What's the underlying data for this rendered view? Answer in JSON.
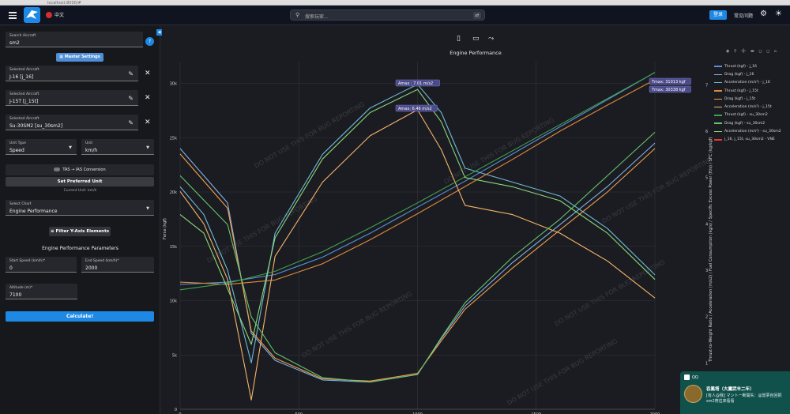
{
  "browser": {
    "url": "localhost:8000/#"
  },
  "topbar": {
    "lang_label": "中文",
    "search_placeholder": "搜索玩家...",
    "login_label": "登录",
    "faq_label": "常见问题"
  },
  "sidebar": {
    "search": {
      "label": "Search Aircraft",
      "value": "sm2"
    },
    "master_settings_label": "Master Settings",
    "selected": [
      {
        "label": "Selected Aircraft",
        "value": "J-16 [j_16]"
      },
      {
        "label": "Selected Aircraft",
        "value": "J-15T [j_15t]"
      },
      {
        "label": "Selected Aircraft",
        "value": "Su-30SM2 [su_30sm2]"
      }
    ],
    "unit_type": {
      "label": "Unit Type",
      "value": "Speed"
    },
    "unit": {
      "label": "Unit",
      "value": "km/h"
    },
    "conversion_label": "TAS → IAS Conversion",
    "preferred_unit_label": "Set Preferred Unit",
    "current_unit_text": "Current Unit: km/h",
    "chart_select": {
      "label": "Select Chart",
      "value": "Engine Performance"
    },
    "filter_label": "Filter Y-Axis Elements",
    "params_title": "Engine Performance Parameters",
    "start_speed": {
      "label": "Start Speed (km/h)*",
      "value": "0"
    },
    "end_speed": {
      "label": "End Speed (km/h)*",
      "value": "2000"
    },
    "altitude": {
      "label": "Altitude (m)*",
      "value": "7100"
    },
    "calculate_label": "Calculate!"
  },
  "chart_panel": {
    "title": "Engine Performance",
    "left_axis_label": "Force (kgf)",
    "right_axis_label": "Thrust-to-Weight Ratio / Acceleration (m/s2) / Fuel Consumption (kg/s) / Specific Excess Power (ft/s) / SFC (kg/kgf)",
    "watermark": "DO NOT USE THIS FOR BUG REPORTING",
    "annotations": {
      "amax1": "Amax : 7.01 m/s2",
      "amax2": "Amax: 6.46 m/s2",
      "tmax1": "Tmax: 31013 kgf",
      "tmax2": "Tmax: 30338 kgf"
    }
  },
  "chart_data": {
    "type": "line",
    "title": "Engine Performance",
    "xlabel": "",
    "ylabel": "Force (kgf)",
    "xlim": [
      0,
      2000
    ],
    "ylim": [
      0,
      32000
    ],
    "y2lim": [
      0,
      7.5
    ],
    "x_ticks": [
      "0",
      "500",
      "1000",
      "1500",
      "2000"
    ],
    "y_ticks": [
      "0",
      "5k",
      "10k",
      "15k",
      "20k",
      "25k",
      "30k"
    ],
    "y2_ticks": [
      "1",
      "2",
      "3",
      "4",
      "5",
      "6",
      "7"
    ],
    "grid": true,
    "legend_position": "right",
    "series": [
      {
        "name": "Thrust (kgf) - j_16",
        "color": "#5b8fd8",
        "axis": "y",
        "x": [
          0,
          200,
          400,
          600,
          800,
          1000,
          1200,
          1400,
          1600,
          1800,
          2000
        ],
        "y": [
          11500,
          11700,
          12400,
          14000,
          16200,
          18600,
          21000,
          23500,
          26000,
          28500,
          31013
        ]
      },
      {
        "name": "Drag (kgf) - j_16",
        "color": "#7fb0e8",
        "axis": "y",
        "x": [
          0,
          200,
          300,
          400,
          600,
          800,
          1000,
          1100,
          1200,
          1400,
          1600,
          1800,
          2000
        ],
        "y": [
          24000,
          19000,
          7000,
          4500,
          2700,
          2500,
          3200,
          6500,
          9500,
          13500,
          17000,
          20500,
          24500
        ]
      },
      {
        "name": "Acceleration (m/s²) - j_16",
        "color": "#6fb9d6",
        "axis": "y2",
        "x": [
          0,
          100,
          200,
          300,
          400,
          600,
          800,
          1000,
          1100,
          1200,
          1400,
          1600,
          1800,
          2000
        ],
        "y": [
          4.8,
          4.2,
          3.0,
          1.0,
          3.8,
          5.5,
          6.5,
          7.01,
          6.4,
          5.2,
          4.9,
          4.6,
          3.9,
          2.9
        ]
      },
      {
        "name": "Thrust (kgf) - j_15t",
        "color": "#e08a3c",
        "axis": "y",
        "x": [
          0,
          200,
          400,
          600,
          800,
          1000,
          1200,
          1400,
          1600,
          1800,
          2000
        ],
        "y": [
          11700,
          11500,
          11900,
          13400,
          15600,
          18000,
          20500,
          23000,
          25600,
          28000,
          30338
        ]
      },
      {
        "name": "Drag (kgf) - j_15t",
        "color": "#f0a04b",
        "axis": "y",
        "x": [
          0,
          200,
          300,
          400,
          600,
          800,
          1000,
          1100,
          1200,
          1400,
          1600,
          1800,
          2000
        ],
        "y": [
          23500,
          18500,
          7200,
          4700,
          2800,
          2600,
          3300,
          6300,
          9200,
          13000,
          16500,
          20000,
          24000
        ]
      },
      {
        "name": "Acceleration (m/s²) - j_15t",
        "color": "#f7b56a",
        "axis": "y2",
        "x": [
          0,
          100,
          200,
          300,
          400,
          600,
          800,
          1000,
          1100,
          1200,
          1400,
          1600,
          1800,
          2000
        ],
        "y": [
          4.7,
          4.0,
          2.8,
          0.2,
          3.3,
          4.9,
          5.9,
          6.46,
          5.6,
          4.4,
          4.2,
          3.8,
          3.2,
          2.4
        ]
      },
      {
        "name": "Thrust (kgf) - su_30sm2",
        "color": "#3fa34d",
        "axis": "y",
        "x": [
          0,
          200,
          400,
          600,
          800,
          1000,
          1200,
          1400,
          1600,
          1800,
          2000
        ],
        "y": [
          11000,
          11600,
          12700,
          14500,
          16700,
          19000,
          21400,
          23800,
          26200,
          28600,
          31000
        ]
      },
      {
        "name": "Drag (kgf) - su_30sm2",
        "color": "#65c46f",
        "axis": "y",
        "x": [
          0,
          200,
          300,
          400,
          600,
          800,
          1000,
          1100,
          1200,
          1400,
          1600,
          1800,
          2000
        ],
        "y": [
          21500,
          17000,
          8500,
          5200,
          2900,
          2500,
          3200,
          6600,
          9800,
          14000,
          17500,
          21500,
          25500
        ]
      },
      {
        "name": "Acceleration (m/s²) - su_30sm2",
        "color": "#8bd67a",
        "axis": "y2",
        "x": [
          0,
          100,
          200,
          300,
          400,
          600,
          800,
          1000,
          1100,
          1200,
          1400,
          1600,
          1800,
          2000
        ],
        "y": [
          4.2,
          3.8,
          2.6,
          1.4,
          3.7,
          5.4,
          6.4,
          6.9,
          6.2,
          5.0,
          4.8,
          4.5,
          3.8,
          2.8
        ]
      },
      {
        "name": "j_16, j_15t, su_30sm2 - VNE",
        "color": "#e53935",
        "axis": "y",
        "x": [],
        "y": []
      }
    ]
  },
  "notification": {
    "app": "QQ",
    "sender": "吞鳳塔（大鷹武丰二年）",
    "message": "[有人@我] マントー断開失：@當夢自回把sm2帶這來看看"
  }
}
